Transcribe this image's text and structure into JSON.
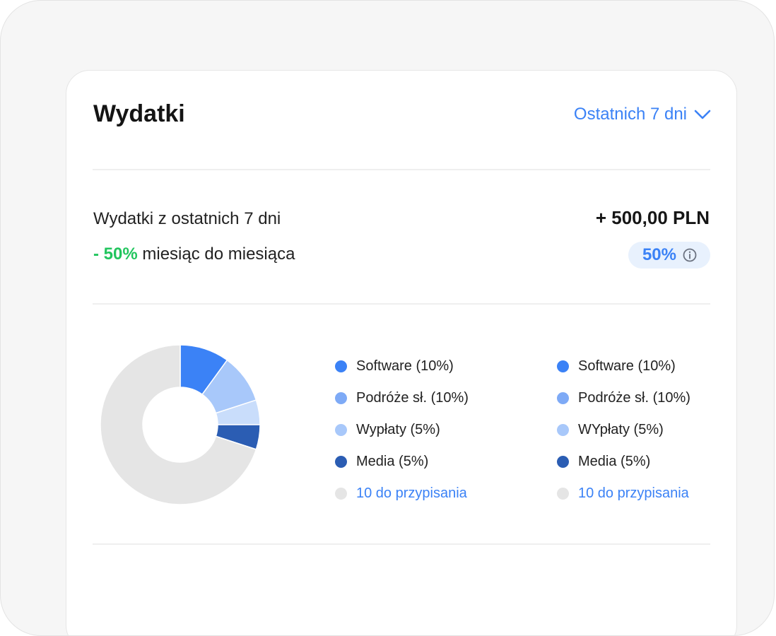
{
  "header": {
    "title": "Wydatki",
    "period_label": "Ostatnich 7 dni",
    "period_icon": "chevron-down-icon"
  },
  "summary": {
    "label": "Wydatki z ostatnich 7 dni",
    "amount": "+ 500,00 PLN",
    "change_value": "- 50%",
    "change_label": "miesiąc do miesiąca",
    "badge_value": "50%",
    "badge_icon": "info-icon"
  },
  "colors": {
    "accent": "#3b82f6",
    "positive": "#22c55e",
    "software": "#3b82f6",
    "travel": "#7eaaf6",
    "payouts": "#a8c8fa",
    "media": "#2b5db3",
    "unassigned": "#e5e5e5"
  },
  "chart_data": {
    "type": "pie",
    "donut": true,
    "slices": [
      {
        "label": "Software",
        "value": 10,
        "color": "#3b82f6"
      },
      {
        "label": "Podróże sł.",
        "value": 10,
        "color": "#a8c8fa"
      },
      {
        "label": "Wypłaty",
        "value": 5,
        "color": "#c9ddfb"
      },
      {
        "label": "Media",
        "value": 5,
        "color": "#2b5db3"
      },
      {
        "label": "10 do przypisania",
        "value": 70,
        "color": "#e5e5e5"
      }
    ]
  },
  "legend_left": [
    {
      "label": "Software (10%)",
      "color": "#3b82f6",
      "link": false
    },
    {
      "label": "Podróże sł. (10%)",
      "color": "#7eaaf6",
      "link": false
    },
    {
      "label": "Wypłaty (5%)",
      "color": "#a8c8fa",
      "link": false
    },
    {
      "label": "Media (5%)",
      "color": "#2b5db3",
      "link": false
    },
    {
      "label": "10 do przypisania",
      "color": "#e5e5e5",
      "link": true
    }
  ],
  "legend_right": [
    {
      "label": "Software (10%)",
      "color": "#3b82f6",
      "link": false
    },
    {
      "label": "Podróże sł. (10%)",
      "color": "#7eaaf6",
      "link": false
    },
    {
      "label": "WYpłaty (5%)",
      "color": "#a8c8fa",
      "link": false
    },
    {
      "label": "Media (5%)",
      "color": "#2b5db3",
      "link": false
    },
    {
      "label": "10 do przypisania",
      "color": "#e5e5e5",
      "link": true
    }
  ]
}
